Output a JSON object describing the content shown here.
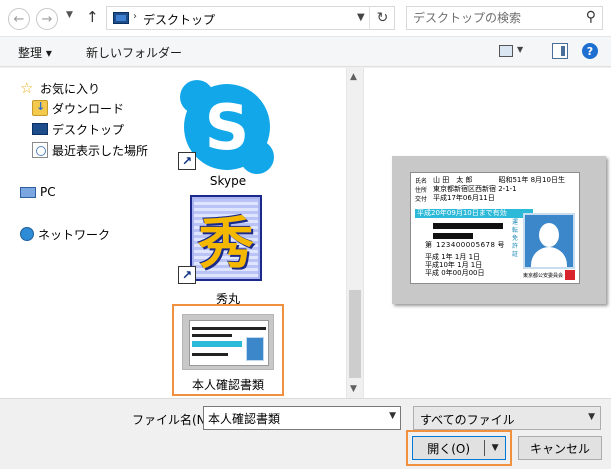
{
  "address_bar": {
    "path_text": "デスクトップ",
    "search_placeholder": "デスクトップの検索"
  },
  "toolbar": {
    "organize_label": "整理 ▾",
    "new_folder_label": "新しいフォルダー",
    "help_label": "?"
  },
  "nav_pane": {
    "items": [
      {
        "label": "お気に入り"
      },
      {
        "label": "ダウンロード"
      },
      {
        "label": "デスクトップ"
      },
      {
        "label": "最近表示した場所"
      },
      {
        "label": "PC"
      },
      {
        "label": "ネットワーク"
      }
    ]
  },
  "files": [
    {
      "label": "Skype",
      "icon": "skype-icon",
      "glyph": "S"
    },
    {
      "label": "秀丸",
      "icon": "hidemaru-icon",
      "glyph": "秀"
    },
    {
      "label": "本人確認書類",
      "icon": "id-card-thumbnail"
    }
  ],
  "preview": {
    "name": "山 田　太 郎",
    "birth": "昭和51年 8月10日生",
    "address": "東京都新宿区西新宿 2-1-1",
    "issued": "平成17年06月11日",
    "validity": "平成20年09月10日まで有効",
    "number_label": "第",
    "number": "123400005678",
    "number_suffix": "号",
    "side_text": "運転免許証",
    "dates": [
      "平成 1年 1月 1日",
      "平成10年 1月 1日",
      "平成 0年00月00日"
    ],
    "authority": "東京都公安委員会"
  },
  "bottom": {
    "filename_label": "ファイル名(N):",
    "filename_value": "本人確認書類",
    "filetype_value": "すべてのファイル",
    "open_label": "開く(O)",
    "cancel_label": "キャンセル"
  },
  "colors": {
    "highlight": "#f2913d",
    "skype": "#12a7e8",
    "accent_blue": "#0078d7"
  }
}
